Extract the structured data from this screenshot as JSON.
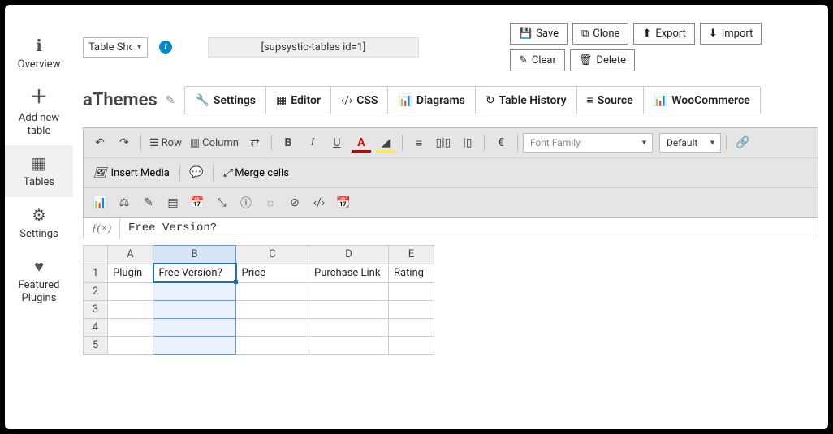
{
  "sidebar": {
    "items": [
      {
        "label": "Overview"
      },
      {
        "label": "Add new table"
      },
      {
        "label": "Tables"
      },
      {
        "label": "Settings"
      },
      {
        "label": "Featured Plugins"
      }
    ]
  },
  "header": {
    "dropdown_value": "Table Sho",
    "shortcode": "[supsystic-tables id=1]"
  },
  "actions": {
    "save": "Save",
    "clone": "Clone",
    "export": "Export",
    "import": "Import",
    "clear": "Clear",
    "delete": "Delete"
  },
  "title": "aThemes",
  "tabs": {
    "settings": "Settings",
    "editor": "Editor",
    "css": "CSS",
    "diagrams": "Diagrams",
    "history": "Table History",
    "source": "Source",
    "woo": "WooCommerce"
  },
  "toolbar": {
    "row": "Row",
    "column": "Column",
    "insert_media": "Insert Media",
    "merge_cells": "Merge cells",
    "font_family_placeholder": "Font Family",
    "size_default": "Default",
    "euro": "€",
    "bold": "B",
    "italic": "I",
    "underline": "U",
    "fontcolor": "A"
  },
  "formula": {
    "label": "ƒ(×)",
    "value": "Free Version?"
  },
  "sheet": {
    "cols": [
      "A",
      "B",
      "C",
      "D",
      "E"
    ],
    "rows": [
      [
        "Plugin",
        "Free Version?",
        "Price",
        "Purchase Link",
        "Rating"
      ],
      [
        "",
        "",
        "",
        "",
        ""
      ],
      [
        "",
        "",
        "",
        "",
        ""
      ],
      [
        "",
        "",
        "",
        "",
        ""
      ],
      [
        "",
        "",
        "",
        "",
        ""
      ]
    ],
    "selected_col": 1,
    "active_row": 0
  }
}
